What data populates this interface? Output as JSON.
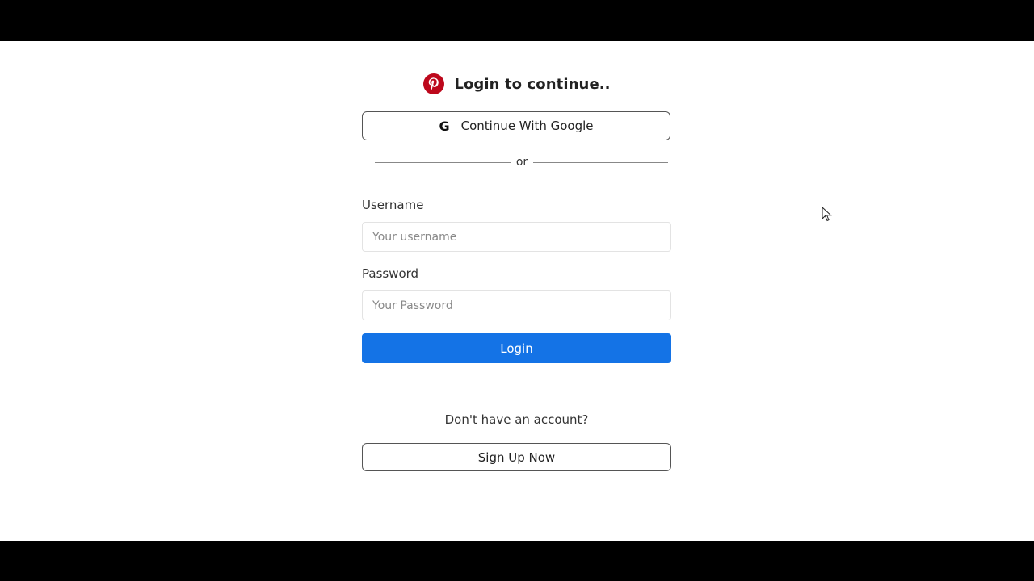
{
  "header": {
    "logo_icon": "pinterest-logo-icon",
    "title": "Login to continue.."
  },
  "google_button": {
    "icon": "google-g-icon",
    "icon_glyph": "G",
    "label": "Continue With Google"
  },
  "divider": {
    "text": "or"
  },
  "form": {
    "username_label": "Username",
    "username_placeholder": "Your username",
    "username_value": "",
    "password_label": "Password",
    "password_placeholder": "Your Password",
    "password_value": "",
    "login_label": "Login"
  },
  "signup": {
    "prompt": "Don't have an account?",
    "button_label": "Sign Up Now"
  },
  "colors": {
    "brand_red": "#bd081c",
    "primary_blue": "#1473e6",
    "border": "#555555"
  }
}
